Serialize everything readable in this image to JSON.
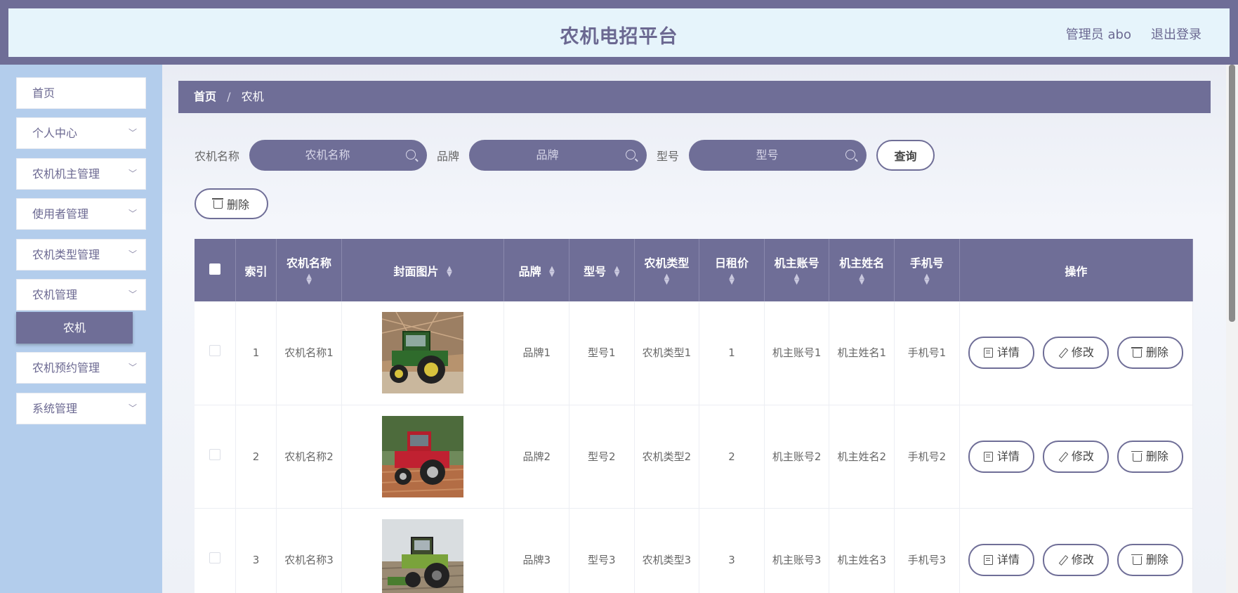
{
  "header": {
    "title": "农机电招平台",
    "user": "管理员 abo",
    "logout": "退出登录"
  },
  "sidebar": {
    "items": [
      {
        "label": "首页",
        "has_children": false
      },
      {
        "label": "个人中心",
        "has_children": true
      },
      {
        "label": "农机机主管理",
        "has_children": true
      },
      {
        "label": "使用者管理",
        "has_children": true
      },
      {
        "label": "农机类型管理",
        "has_children": true
      },
      {
        "label": "农机管理",
        "has_children": true
      },
      {
        "label": "农机预约管理",
        "has_children": true
      },
      {
        "label": "系统管理",
        "has_children": true
      }
    ],
    "active_sub": "农机"
  },
  "breadcrumb": {
    "home": "首页",
    "separator": "/",
    "current": "农机"
  },
  "search": {
    "name_label": "农机名称",
    "name_placeholder": "农机名称",
    "brand_label": "品牌",
    "brand_placeholder": "品牌",
    "model_label": "型号",
    "model_placeholder": "型号",
    "query_button": "查询"
  },
  "toolbar": {
    "delete_button": "删除"
  },
  "table": {
    "headers": {
      "index": "索引",
      "name": "农机名称",
      "cover": "封面图片",
      "brand": "品牌",
      "model": "型号",
      "type": "农机类型",
      "price": "日租价",
      "owner_account": "机主账号",
      "owner_name": "机主姓名",
      "phone": "手机号",
      "actions": "操作"
    },
    "action_labels": {
      "detail": "详情",
      "edit": "修改",
      "delete": "删除"
    },
    "rows": [
      {
        "index": "1",
        "name": "农机名称1",
        "brand": "品牌1",
        "model": "型号1",
        "type": "农机类型1",
        "price": "1",
        "owner_account": "机主账号1",
        "owner_name": "机主姓名1",
        "phone": "手机号1"
      },
      {
        "index": "2",
        "name": "农机名称2",
        "brand": "品牌2",
        "model": "型号2",
        "type": "农机类型2",
        "price": "2",
        "owner_account": "机主账号2",
        "owner_name": "机主姓名2",
        "phone": "手机号2"
      },
      {
        "index": "3",
        "name": "农机名称3",
        "brand": "品牌3",
        "model": "型号3",
        "type": "农机类型3",
        "price": "3",
        "owner_account": "机主账号3",
        "owner_name": "机主姓名3",
        "phone": "手机号3"
      }
    ]
  },
  "colors": {
    "primary": "#6f6e97",
    "header_bg": "#e6f4fb",
    "sidebar_bg": "#b3cdec"
  }
}
